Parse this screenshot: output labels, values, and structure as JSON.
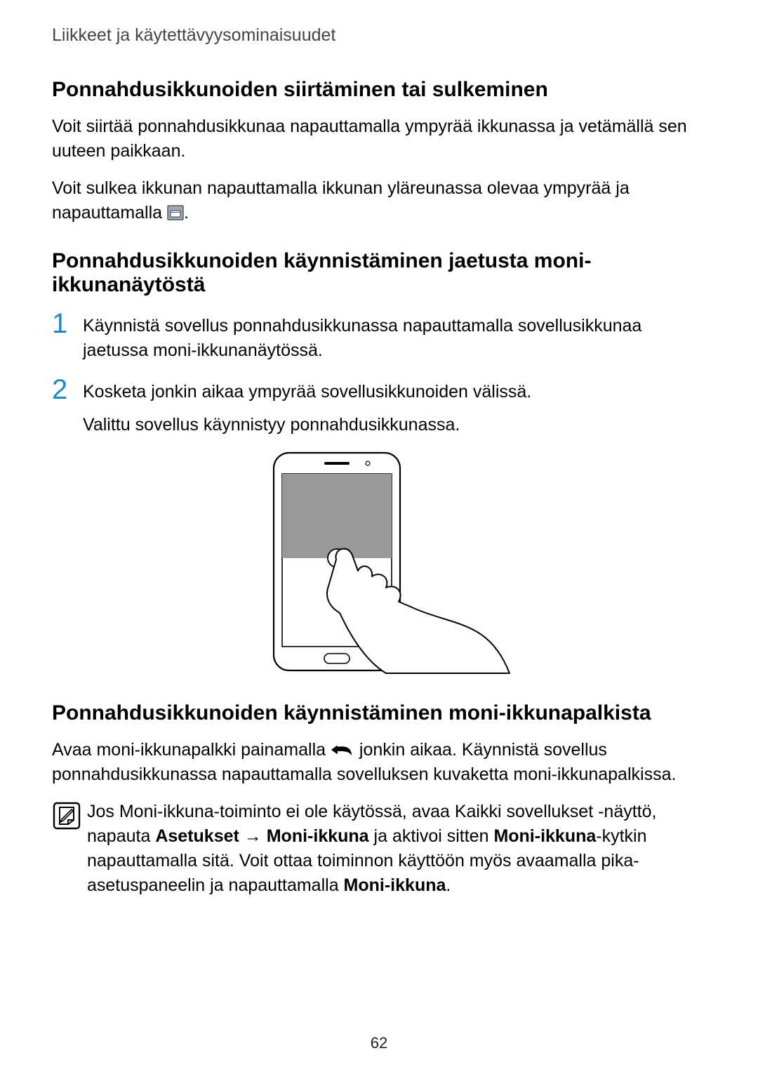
{
  "header": "Liikkeet ja käytettävyysominaisuudet",
  "section1": {
    "heading": "Ponnahdusikkunoiden siirtäminen tai sulkeminen",
    "p1": "Voit siirtää ponnahdusikkunaa napauttamalla ympyrää ikkunassa ja vetämällä sen uuteen paikkaan.",
    "p2_pre": "Voit sulkea ikkunan napauttamalla ikkunan yläreunassa olevaa ympyrää ja napauttamalla ",
    "p2_post": "."
  },
  "section2": {
    "heading": "Ponnahdusikkunoiden käynnistäminen jaetusta moni-ikkunanäytöstä",
    "step1": "Käynnistä sovellus ponnahdusikkunassa napauttamalla sovellusikkunaa jaetussa moni-ikkunanäytössä.",
    "step2_line1": "Kosketa jonkin aikaa ympyrää sovellusikkunoiden välissä.",
    "step2_line2": "Valittu sovellus käynnistyy ponnahdusikkunassa."
  },
  "section3": {
    "heading": "Ponnahdusikkunoiden käynnistäminen moni-ikkunapalkista",
    "p1_pre": "Avaa moni-ikkunapalkki painamalla ",
    "p1_post": " jonkin aikaa. Käynnistä sovellus ponnahdusikkunassa napauttamalla sovelluksen kuvaketta moni-ikkunapalkissa."
  },
  "note": {
    "pre": "Jos Moni-ikkuna-toiminto ei ole käytössä, avaa Kaikki sovellukset -näyttö, napauta ",
    "bold1": "Asetukset",
    "arrow": " → ",
    "bold2": "Moni-ikkuna",
    "mid1": " ja aktivoi sitten ",
    "bold3": "Moni-ikkuna",
    "mid2": "-kytkin napauttamalla sitä. Voit ottaa toiminnon käyttöön myös avaamalla pika-asetuspaneelin ja napauttamalla ",
    "bold4": "Moni-ikkuna",
    "post": "."
  },
  "page_number": "62",
  "icons": {
    "close_window": "close-window-icon",
    "back": "back-icon",
    "note": "note-icon"
  }
}
